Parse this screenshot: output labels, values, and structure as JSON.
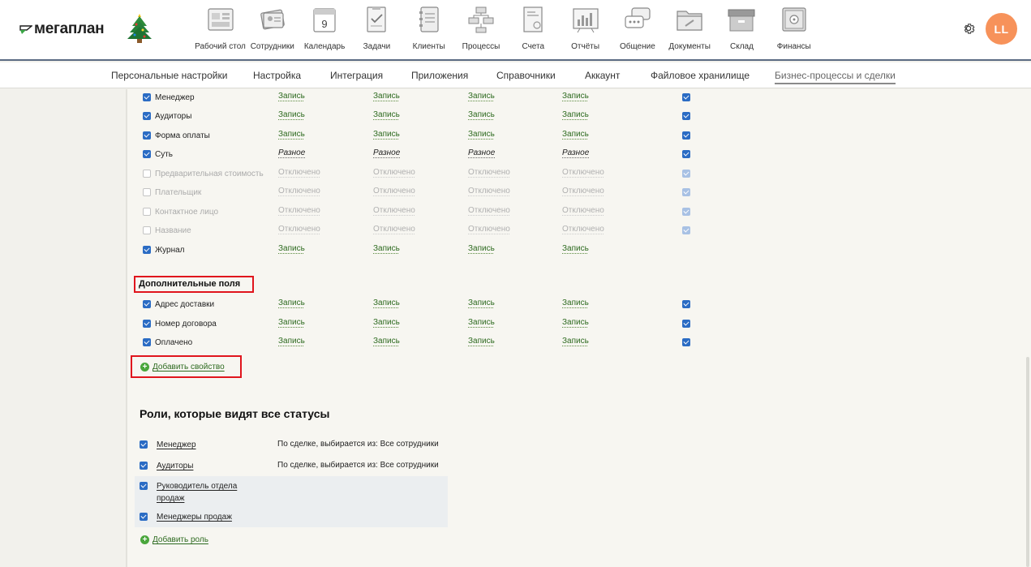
{
  "header": {
    "logo_text": "мегаплан",
    "nav": [
      {
        "label": "Рабочий стол",
        "icon": "desktop-icon"
      },
      {
        "label": "Сотрудники",
        "icon": "employees-icon"
      },
      {
        "label": "Календарь",
        "icon": "calendar-icon",
        "icon_text": "9"
      },
      {
        "label": "Задачи",
        "icon": "tasks-icon"
      },
      {
        "label": "Клиенты",
        "icon": "clients-icon"
      },
      {
        "label": "Процессы",
        "icon": "processes-icon"
      },
      {
        "label": "Счета",
        "icon": "invoices-icon"
      },
      {
        "label": "Отчёты",
        "icon": "reports-icon"
      },
      {
        "label": "Общение",
        "icon": "chat-icon"
      },
      {
        "label": "Документы",
        "icon": "documents-icon"
      },
      {
        "label": "Склад",
        "icon": "warehouse-icon"
      },
      {
        "label": "Финансы",
        "icon": "finance-icon"
      }
    ],
    "avatar_initials": "LL"
  },
  "submenu": [
    {
      "label": "Персональные настройки",
      "active": false
    },
    {
      "label": "Настройка",
      "active": false
    },
    {
      "label": "Интеграция",
      "active": false
    },
    {
      "label": "Приложения",
      "active": false
    },
    {
      "label": "Справочники",
      "active": false
    },
    {
      "label": "Аккаунт",
      "active": false
    },
    {
      "label": "Файловое хранилище",
      "active": false
    },
    {
      "label": "Бизнес-процессы и сделки",
      "active": true
    }
  ],
  "fields": [
    {
      "name": "Менеджер",
      "state": "on",
      "perms": [
        "Запись",
        "Запись",
        "Запись",
        "Запись"
      ],
      "kind": "rec",
      "right": "on"
    },
    {
      "name": "Аудиторы",
      "state": "on",
      "perms": [
        "Запись",
        "Запись",
        "Запись",
        "Запись"
      ],
      "kind": "rec",
      "right": "on"
    },
    {
      "name": "Форма оплаты",
      "state": "on",
      "perms": [
        "Запись",
        "Запись",
        "Запись",
        "Запись"
      ],
      "kind": "rec",
      "right": "on"
    },
    {
      "name": "Суть",
      "state": "on",
      "perms": [
        "Разное",
        "Разное",
        "Разное",
        "Разное"
      ],
      "kind": "mix",
      "right": "on"
    },
    {
      "name": "Предварительная стоимость",
      "state": "off",
      "perms": [
        "Отключено",
        "Отключено",
        "Отключено",
        "Отключено"
      ],
      "kind": "offtxt",
      "right": "dim"
    },
    {
      "name": "Плательщик",
      "state": "off",
      "perms": [
        "Отключено",
        "Отключено",
        "Отключено",
        "Отключено"
      ],
      "kind": "offtxt",
      "right": "dim"
    },
    {
      "name": "Контактное лицо",
      "state": "off",
      "perms": [
        "Отключено",
        "Отключено",
        "Отключено",
        "Отключено"
      ],
      "kind": "offtxt",
      "right": "dim"
    },
    {
      "name": "Название",
      "state": "off",
      "perms": [
        "Отключено",
        "Отключено",
        "Отключено",
        "Отключено"
      ],
      "kind": "offtxt",
      "right": "dim"
    },
    {
      "name": "Журнал",
      "state": "on",
      "perms": [
        "Запись",
        "Запись",
        "Запись",
        "Запись"
      ],
      "kind": "rec",
      "right": "none"
    }
  ],
  "extra_section": {
    "title": "Дополнительные поля",
    "fields": [
      {
        "name": "Адрес доставки",
        "perms": [
          "Запись",
          "Запись",
          "Запись",
          "Запись"
        ]
      },
      {
        "name": "Номер договора",
        "perms": [
          "Запись",
          "Запись",
          "Запись",
          "Запись"
        ]
      },
      {
        "name": "Оплачено",
        "perms": [
          "Запись",
          "Запись",
          "Запись",
          "Запись"
        ]
      }
    ],
    "add_property": "Добавить свойство"
  },
  "roles_section": {
    "title": "Роли, которые видят все статусы",
    "roles": [
      {
        "name": "Менеджер",
        "desc": "По сделке, выбирается из: Все сотрудники"
      },
      {
        "name": "Аудиторы",
        "desc": "По сделке, выбирается из: Все сотрудники"
      },
      {
        "name": "Руководитель отдела продаж",
        "desc": ""
      },
      {
        "name": "Менеджеры продаж",
        "desc": ""
      }
    ],
    "add_role": "Добавить роль"
  },
  "colors": {
    "accent_blue": "#2b6cc4",
    "link_green": "#2d6a1f",
    "highlight_red": "#e0151d",
    "avatar": "#f7925a"
  }
}
